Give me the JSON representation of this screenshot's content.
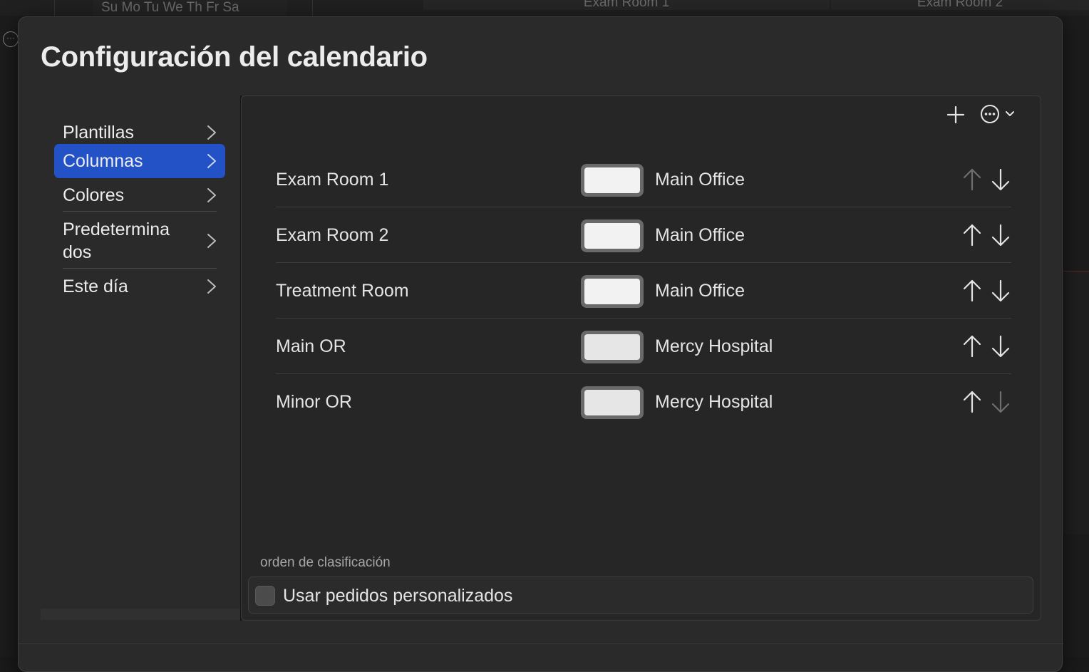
{
  "background": {
    "minical_days": "Su Mo Tu We Th Fr Sa",
    "column_headers": [
      "Exam Room 1",
      "Exam Room 2"
    ]
  },
  "sheet": {
    "title": "Configuración del calendario"
  },
  "sidebar": {
    "items": [
      {
        "label": "Plantillas",
        "selected": false
      },
      {
        "label": "Columnas",
        "selected": true
      },
      {
        "label": "Colores",
        "selected": false
      },
      {
        "label": "Predetermina\ndos",
        "selected": false
      },
      {
        "label": "Este día",
        "selected": false
      }
    ]
  },
  "toolbar": {
    "add_icon": "plus-icon",
    "more_icon": "ellipsis-circle-icon",
    "more_chevron_icon": "chevron-down-icon"
  },
  "columns": [
    {
      "name": "Exam Room 1",
      "location": "Main Office",
      "color": "#f2f2f2",
      "up_enabled": false,
      "down_enabled": true
    },
    {
      "name": "Exam Room 2",
      "location": "Main Office",
      "color": "#f2f2f2",
      "up_enabled": true,
      "down_enabled": true
    },
    {
      "name": "Treatment Room",
      "location": "Main Office",
      "color": "#f2f2f2",
      "up_enabled": true,
      "down_enabled": true
    },
    {
      "name": "Main OR",
      "location": "Mercy Hospital",
      "color": "#e6e6e6",
      "up_enabled": true,
      "down_enabled": true
    },
    {
      "name": "Minor OR",
      "location": "Mercy Hospital",
      "color": "#e6e6e6",
      "up_enabled": true,
      "down_enabled": false
    }
  ],
  "sort": {
    "caption": "orden de clasificación",
    "checkbox_label": "Usar pedidos personalizados",
    "checked": false
  },
  "colors": {
    "accent": "#2352c7",
    "enabled_arrow": "#e4e4e4",
    "disabled_arrow": "#6e6e6e"
  }
}
